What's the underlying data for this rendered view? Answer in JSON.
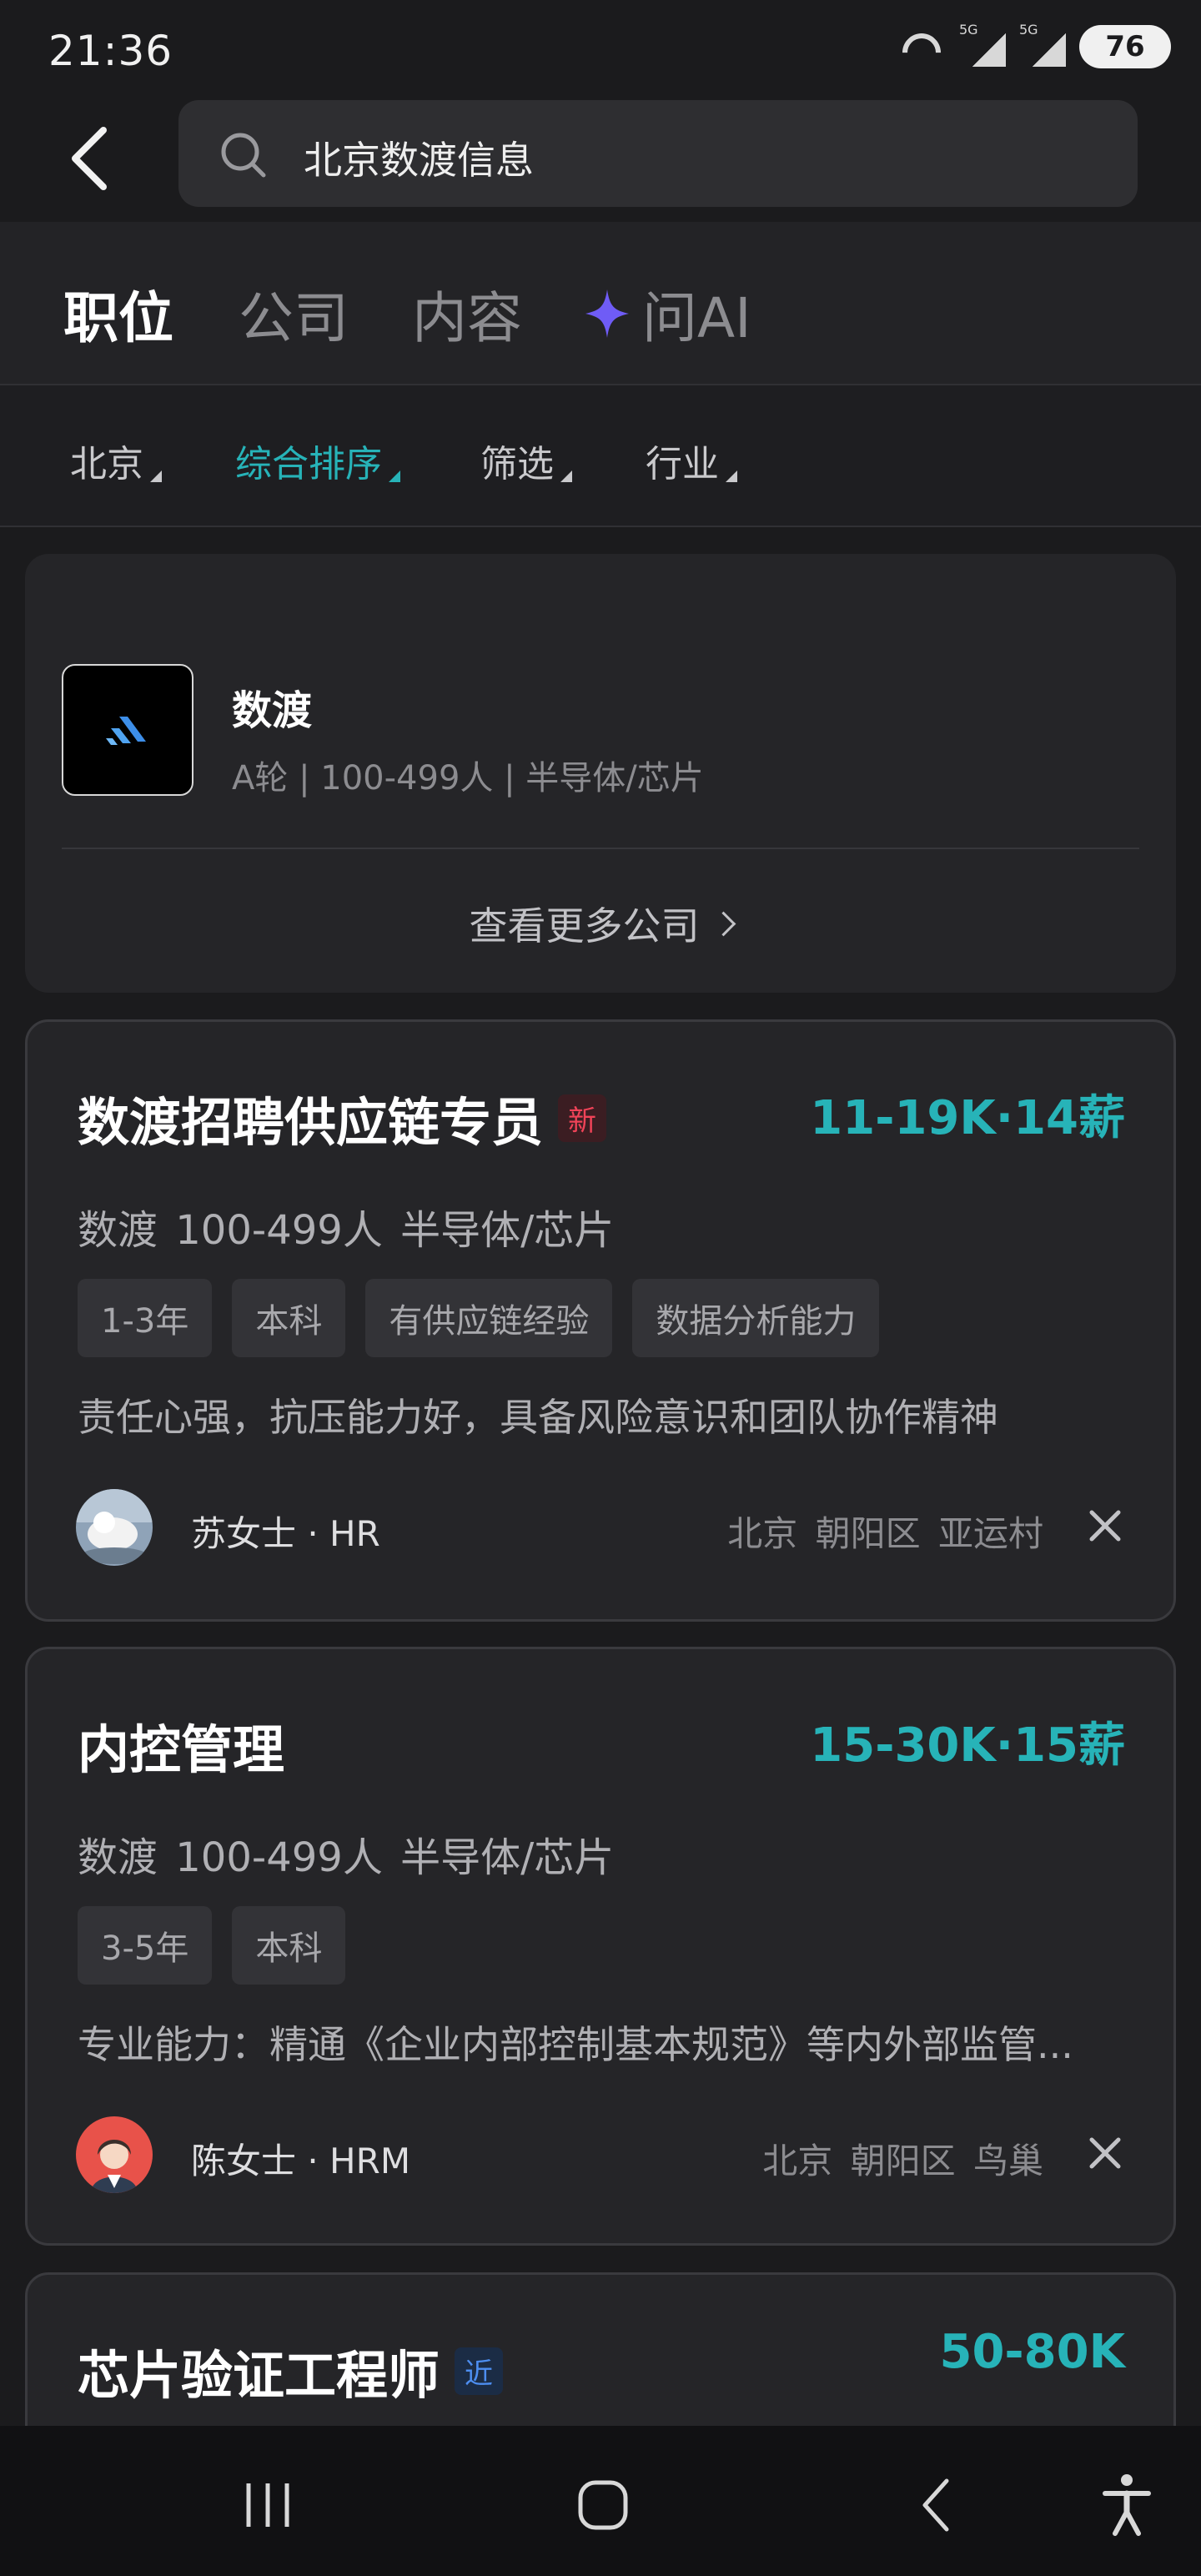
{
  "status_bar": {
    "time": "21:36",
    "battery": "76",
    "signal_1": "5G",
    "signal_2": "5G"
  },
  "search": {
    "query": "北京数渡信息"
  },
  "tabs": [
    {
      "label": "职位"
    },
    {
      "label": "公司"
    },
    {
      "label": "内容"
    },
    {
      "label": "问AI"
    }
  ],
  "filters": [
    {
      "label": "北京"
    },
    {
      "label": "综合排序"
    },
    {
      "label": "筛选"
    },
    {
      "label": "行业"
    }
  ],
  "company_card": {
    "name": "数渡",
    "meta": "A轮 | 100-499人 | 半导体/芯片",
    "more_label": "查看更多公司"
  },
  "jobs": [
    {
      "title": "数渡招聘供应链专员",
      "badge": "新",
      "salary": "11-19K·14薪",
      "company": "数渡  100-499人  半导体/芯片",
      "tags": [
        "1-3年",
        "本科",
        "有供应链经验",
        "数据分析能力"
      ],
      "description": "责任心强，抗压能力好，具备风险意识和团队协作精神",
      "hr": "苏女士 · HR",
      "location": "北京  朝阳区  亚运村"
    },
    {
      "title": "内控管理",
      "salary": "15-30K·15薪",
      "company": "数渡  100-499人  半导体/芯片",
      "tags": [
        "3-5年",
        "本科"
      ],
      "description": "专业能力：精通《企业内部控制基本规范》等内外部监管...",
      "hr": "陈女士 · HRM",
      "location": "北京  朝阳区  鸟巢"
    },
    {
      "title": "芯片验证工程师",
      "badge": "近",
      "salary": "50-80K"
    }
  ],
  "colors": {
    "accent": "#27b3b8",
    "background": "#1b1b1d",
    "card": "#252528",
    "new_badge": "#f04358",
    "near_badge": "#4d8ef0",
    "ai_star": "#6f5cf6"
  }
}
